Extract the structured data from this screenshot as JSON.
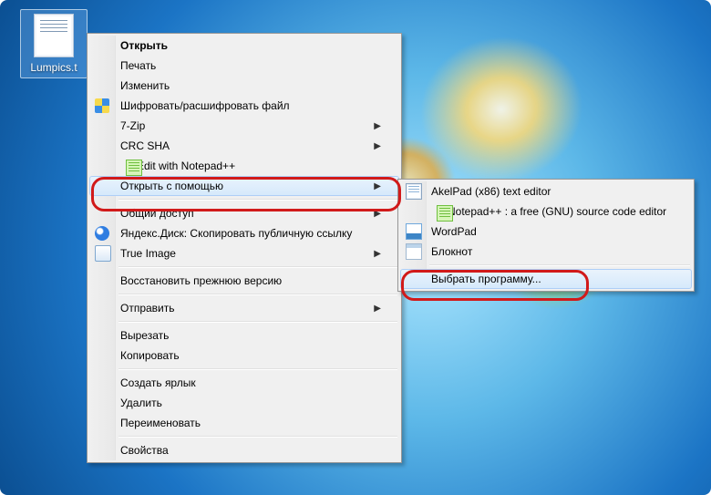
{
  "desktop": {
    "file_label": "Lumpics.t"
  },
  "menu": {
    "open": "Открыть",
    "print": "Печать",
    "edit": "Изменить",
    "encrypt": "Шифровать/расшифровать файл",
    "sevenzip": "7-Zip",
    "crcsha": "CRC SHA",
    "editnpp": "Edit with Notepad++",
    "openwith": "Открыть с помощью",
    "share": "Общий доступ",
    "yadisk": "Яндекс.Диск: Скопировать публичную ссылку",
    "trueimage": "True Image",
    "restore": "Восстановить прежнюю версию",
    "sendto": "Отправить",
    "cut": "Вырезать",
    "copy": "Копировать",
    "shortcut": "Создать ярлык",
    "delete": "Удалить",
    "rename": "Переименовать",
    "properties": "Свойства"
  },
  "submenu": {
    "akelpad": "AkelPad (x86) text editor",
    "npp": "Notepad++ : a free (GNU) source code editor",
    "wordpad": "WordPad",
    "notepad": "Блокнот",
    "choose": "Выбрать программу..."
  }
}
